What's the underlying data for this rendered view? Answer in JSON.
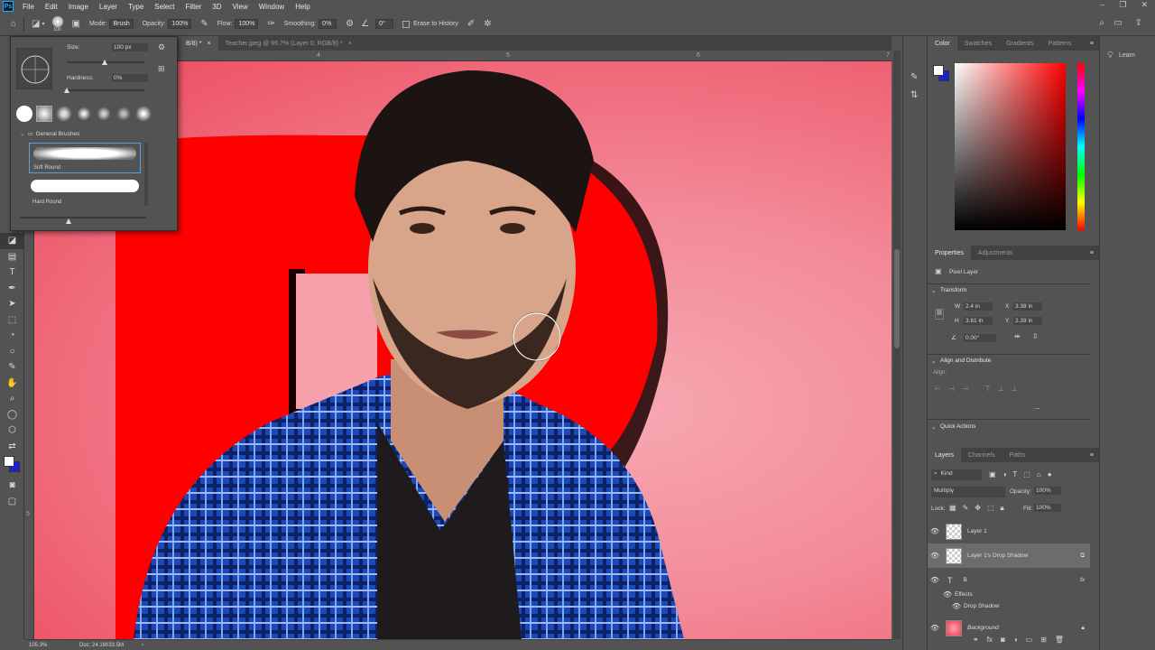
{
  "menu": {
    "logo": "Ps",
    "items": [
      "File",
      "Edit",
      "Image",
      "Layer",
      "Type",
      "Select",
      "Filter",
      "3D",
      "View",
      "Window",
      "Help"
    ]
  },
  "window_controls": {
    "minimize": "–",
    "restore": "❐",
    "close": "✕"
  },
  "options_bar": {
    "brush_size_badge": "100",
    "mode_label": "Mode:",
    "mode_value": "Brush",
    "opacity_label": "Opacity:",
    "opacity_value": "100%",
    "flow_label": "Flow:",
    "flow_value": "100%",
    "smoothing_label": "Smoothing:",
    "smoothing_value": "0%",
    "angle_value": "0°",
    "erase_history_label": "Erase to History"
  },
  "tabs": [
    {
      "label": "B/8) *"
    },
    {
      "label": "Teacher.jpeg @ 66.7% (Layer 0, RGB/8) *"
    }
  ],
  "ruler": {
    "ticks": [
      "4",
      "5",
      "6",
      "7"
    ]
  },
  "vruler": {
    "ticks": [
      "5"
    ]
  },
  "brush_popup": {
    "size_label": "Size:",
    "size_value": "100 px",
    "hardness_label": "Hardness:",
    "hardness_value": "0%",
    "folder_label": "General Brushes",
    "brushes": [
      {
        "name": "Soft Round"
      },
      {
        "name": "Hard Round"
      }
    ]
  },
  "status": {
    "zoom": "105.3%",
    "doc": "Doc: 24.1M/33.5M"
  },
  "color_panel": {
    "tabs": [
      "Color",
      "Swatches",
      "Gradients",
      "Patterns"
    ],
    "foreground": "#ffffff",
    "background": "#1f1fd8"
  },
  "properties": {
    "tabs": [
      "Properties",
      "Adjustments"
    ],
    "layer_type": "Pixel Layer",
    "transform_label": "Transform",
    "w_label": "W",
    "w_value": "2.4 in",
    "h_label": "H",
    "h_value": "3.81 in",
    "x_label": "X",
    "x_value": "3.38 in",
    "y_label": "Y",
    "y_value": "2.39 in",
    "angle_value": "0.00°",
    "align_label": "Align and Distribute",
    "align_sub": "Align:",
    "quick_actions": "Quick Actions",
    "more": "..."
  },
  "layers_panel": {
    "tabs": [
      "Layers",
      "Channels",
      "Paths"
    ],
    "kind_label": "Kind",
    "blend_mode": "Multiply",
    "opacity_label": "Opacity:",
    "opacity_value": "100%",
    "lock_label": "Lock:",
    "fill_label": "Fill:",
    "fill_value": "100%",
    "layers": [
      {
        "name": "Layer 1"
      },
      {
        "name": "Layer 1's Drop Shadow"
      },
      {
        "name": "B",
        "fx": "fx"
      },
      {
        "name": "Effects"
      },
      {
        "name": "Drop Shadow"
      },
      {
        "name": "Background"
      }
    ]
  },
  "learn": {
    "label": "Learn"
  },
  "colors": {
    "accent_red": "#ff0000",
    "canvas_pink": "#f38a98",
    "panel": "#535353"
  }
}
